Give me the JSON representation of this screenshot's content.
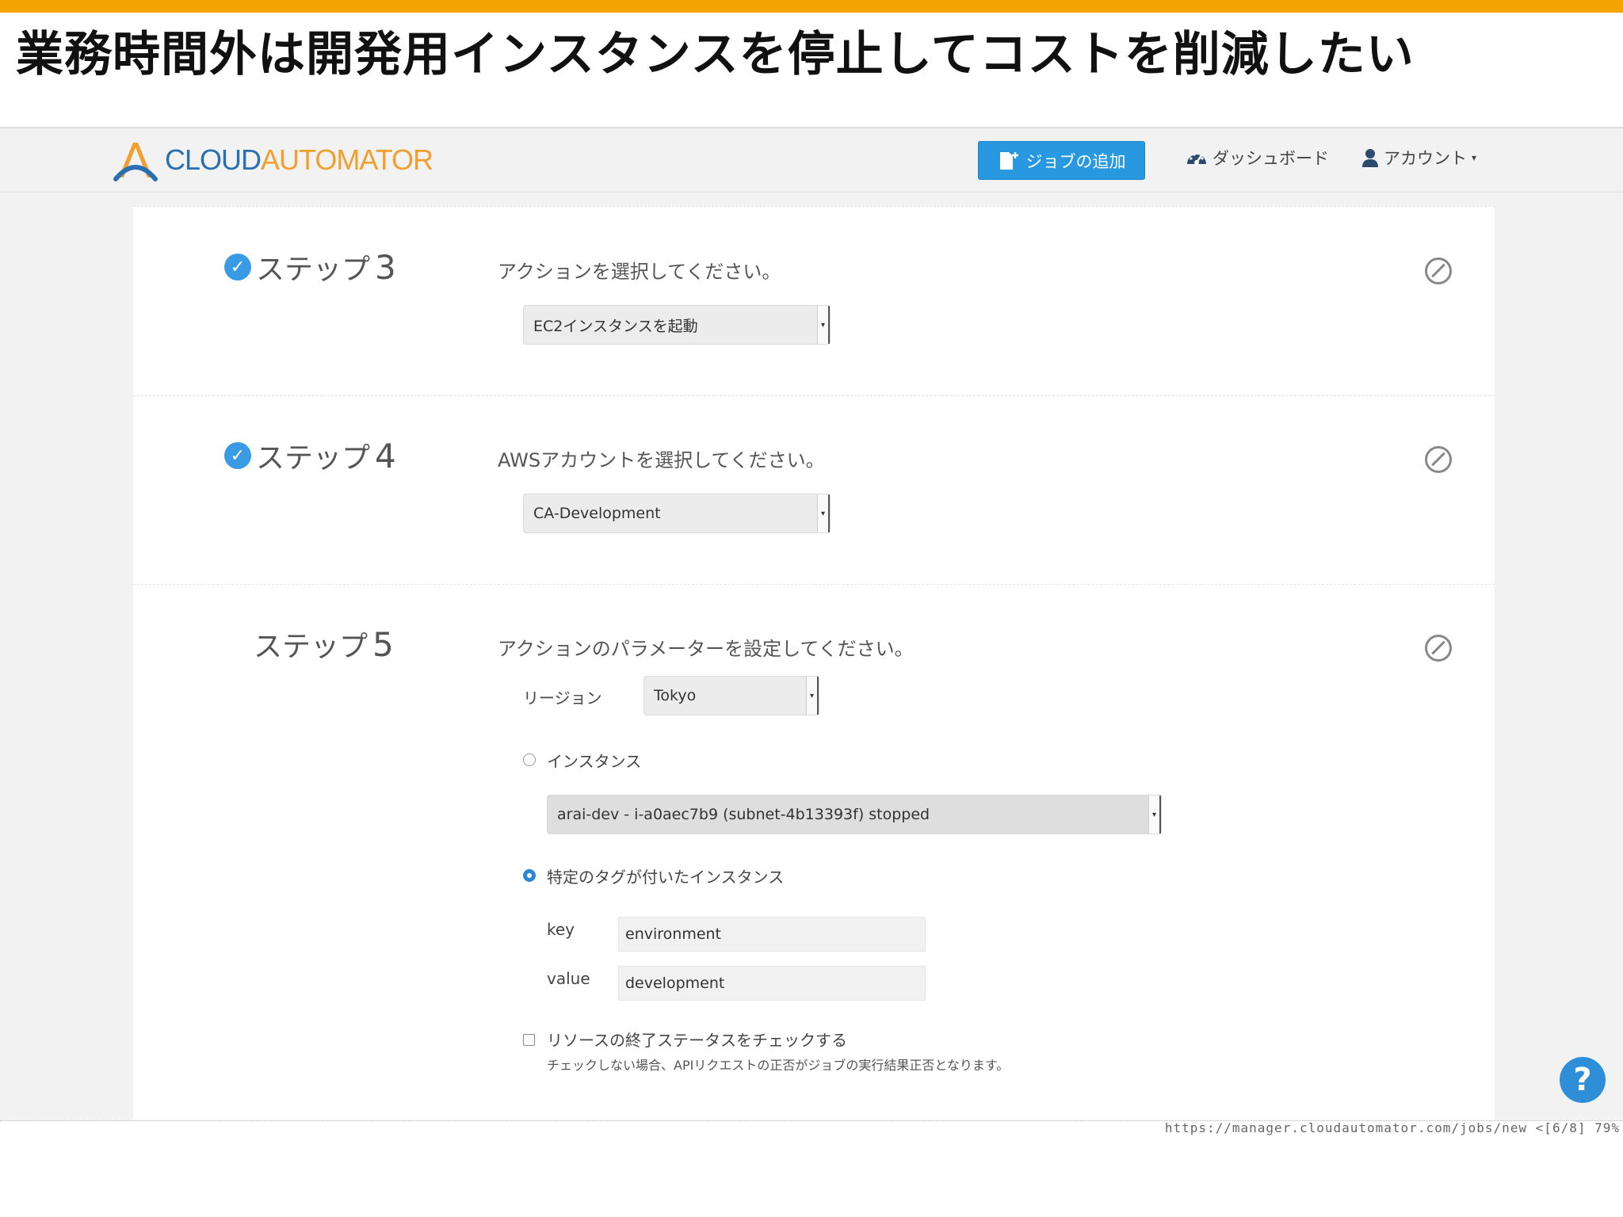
{
  "slide": {
    "title": "業務時間外は開発用インスタンスを停止してコストを削減したい",
    "accent_color": "#f4a400"
  },
  "navbar": {
    "logo_cloud": "CLOUD",
    "logo_automator": "AUTOMATOR",
    "add_job_label": "ジョブの追加",
    "dashboard_label": "ダッシュボード",
    "account_label": "アカウント",
    "primary_color": "#2898e0"
  },
  "steps": [
    {
      "label": "ステップ",
      "number": "3",
      "completed": true,
      "description": "アクションを選択してください。",
      "select_value": "EC2インスタンスを起動"
    },
    {
      "label": "ステップ",
      "number": "4",
      "completed": true,
      "description": "AWSアカウントを選択してください。",
      "select_value": "CA-Development"
    },
    {
      "label": "ステップ",
      "number": "5",
      "completed": false,
      "description": "アクションのパラメーターを設定してください。"
    }
  ],
  "params": {
    "region_label": "リージョン",
    "region_value": "Tokyo",
    "instance_option_label": "インスタンス",
    "instance_value": "arai-dev - i-a0aec7b9 (subnet-4b13393f) stopped",
    "tag_option_label": "特定のタグが付いたインスタンス",
    "key_label": "key",
    "key_value": "environment",
    "value_label": "value",
    "value_value": "development",
    "check_status_label": "リソースの終了ステータスをチェックする",
    "check_status_note": "チェックしない場合、APIリクエストの正否がジョブの実行結果正否となります。"
  },
  "help_label": "?",
  "status_url": "https://manager.cloudautomator.com/jobs/new <[6/8] 79%"
}
